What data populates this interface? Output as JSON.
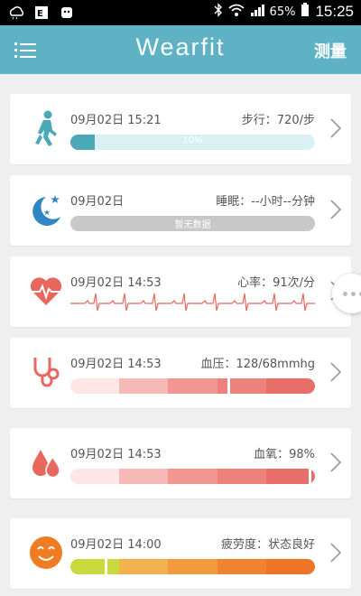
{
  "status_bar": {
    "battery": "65%",
    "time": "15:25",
    "icons": [
      "weather-icon",
      "news-icon",
      "android-icon",
      "bluetooth-icon",
      "wifi-icon",
      "signal-icon",
      "battery-icon"
    ]
  },
  "header": {
    "title": "Wearfit",
    "measure_label": "测量",
    "menu_icon": "menu-icon"
  },
  "colors": {
    "header": "#5fb2c5",
    "steps_icon": "#4aa9b6",
    "sleep_icon": "#2f86c2",
    "heart": "#e8675f",
    "bp_track": [
      "#fde7e6",
      "#f7b9b5",
      "#f19690",
      "#ec827b",
      "#e86f67"
    ],
    "spo2_track": [
      "#fde7e6",
      "#f7b9b5",
      "#f19690",
      "#ec827b",
      "#e86f67"
    ],
    "fatigue_track": [
      "#c9d83d",
      "#f2b34e",
      "#f19a3e",
      "#ef8330",
      "#ee7428"
    ]
  },
  "cards": {
    "steps": {
      "time": "09月02日 15:21",
      "reading": "步行：720/步",
      "progress_text": "10%",
      "progress_fraction": 0.1,
      "icon": "walking-icon"
    },
    "sleep": {
      "time": "09月02日",
      "reading": "睡眠：--小时--分钟",
      "bar_text": "暂无数据",
      "icon": "moon-star-icon"
    },
    "heart_rate": {
      "time": "09月02日 14:53",
      "reading": "心率：91次/分",
      "icon": "heart-pulse-icon"
    },
    "blood_pressure": {
      "time": "09月02日 14:53",
      "reading": "血压：128/68mmhg",
      "marker_fraction": 0.65,
      "icon": "stethoscope-icon"
    },
    "blood_oxygen": {
      "time": "09月02日 14:53",
      "reading": "血氧：98%",
      "marker_fraction": 0.985,
      "icon": "blood-drop-icon"
    },
    "fatigue": {
      "time": "09月02日 14:00",
      "reading": "疲劳度：状态良好",
      "marker_fraction": 0.14,
      "icon": "smiley-face-icon"
    }
  }
}
